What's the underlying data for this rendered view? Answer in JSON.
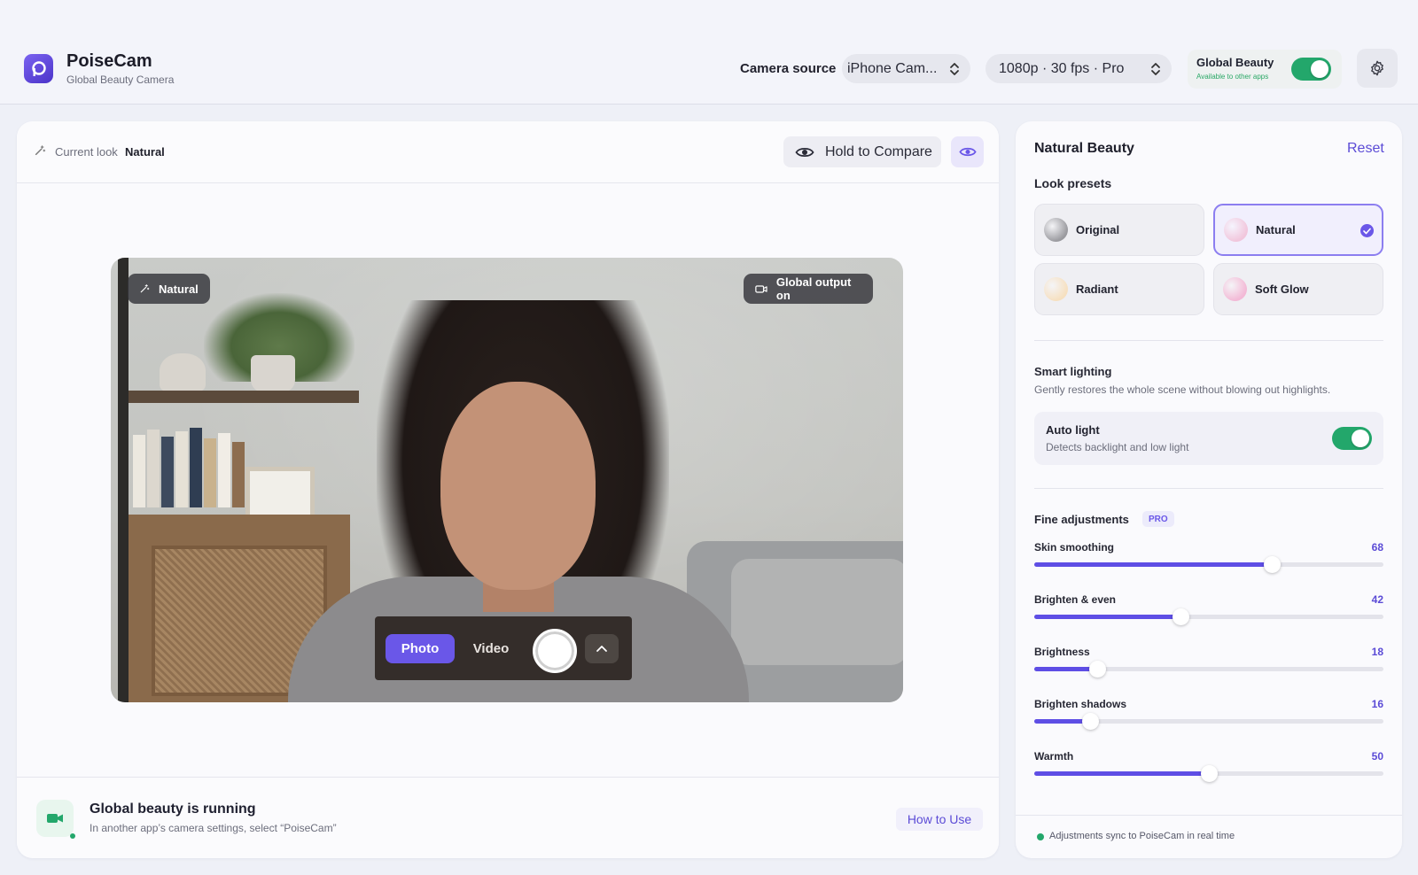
{
  "app": {
    "name": "PoiseCam",
    "subtitle": "Global Beauty Camera",
    "accent": "#6a57e8",
    "success": "#23a76b"
  },
  "header": {
    "camera_source_label": "Camera source",
    "camera_source_value": "iPhone Cam...",
    "format_value": "1080p · 30 fps · Pro",
    "global_beauty_title": "Global Beauty",
    "global_beauty_sub": "Available to other apps",
    "global_beauty_on": true,
    "settings_icon": "gear-icon"
  },
  "preview": {
    "current_look_label": "Current look",
    "current_look_value": "Natural",
    "compare_label": "Hold to Compare",
    "overlay_look": "Natural",
    "overlay_output": "Global output on",
    "mode_photo": "Photo",
    "mode_video": "Video",
    "active_mode": "Photo"
  },
  "status": {
    "title": "Global beauty is running",
    "subtitle": "In another app’s camera settings, select “PoiseCam”",
    "how_to_label": "How to Use"
  },
  "panel": {
    "title": "Natural Beauty",
    "reset_label": "Reset",
    "presets_heading": "Look presets",
    "presets": [
      {
        "name": "Original",
        "color": "#9a9a9f",
        "selected": false
      },
      {
        "name": "Natural",
        "color": "#f1c6dc",
        "selected": true
      },
      {
        "name": "Radiant",
        "color": "#f6e0c0",
        "selected": false
      },
      {
        "name": "Soft Glow",
        "color": "#f3b9d6",
        "selected": false
      }
    ],
    "lighting_heading": "Smart lighting",
    "lighting_desc": "Gently restores the whole scene without blowing out highlights.",
    "auto_light_title": "Auto light",
    "auto_light_sub": "Detects backlight and low light",
    "auto_light_on": true,
    "fine_heading": "Fine adjustments",
    "pro_badge": "PRO",
    "sliders": [
      {
        "label": "Skin smoothing",
        "value": "68",
        "level": 0.68
      },
      {
        "label": "Brighten & even",
        "value": "42",
        "level": 0.42
      },
      {
        "label": "Brightness",
        "value": "18",
        "level": 0.18
      },
      {
        "label": "Brighten shadows",
        "value": "16",
        "level": 0.16
      },
      {
        "label": "Warmth",
        "value": "50",
        "level": 0.5
      }
    ],
    "sync_text": "Adjustments sync to PoiseCam in real time"
  }
}
